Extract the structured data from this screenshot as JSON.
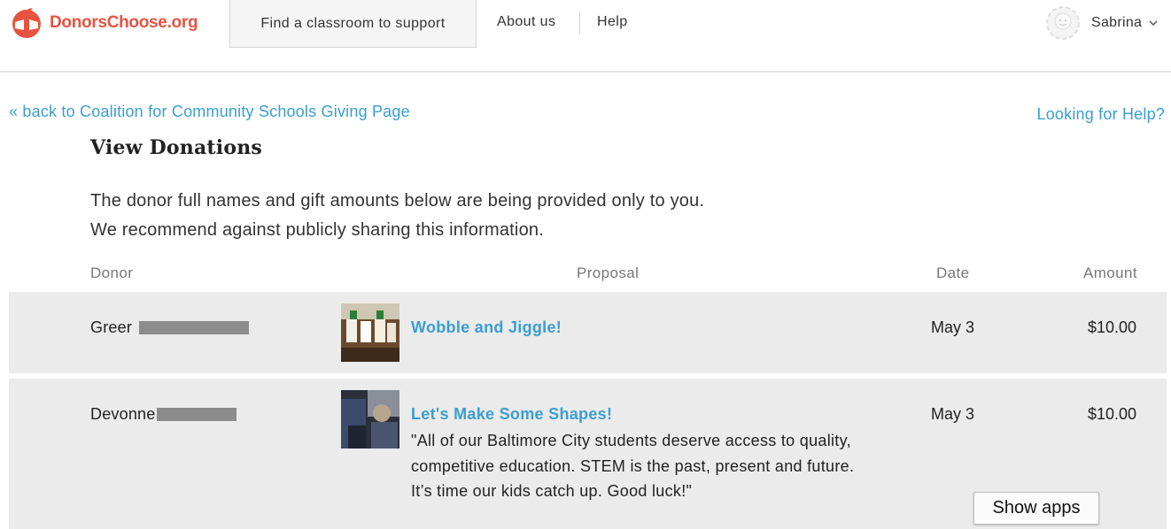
{
  "header": {
    "logo_text": "DonorsChoose.org",
    "find_label": "Find a classroom to support",
    "about_label": "About us",
    "help_label": "Help",
    "user_name": "Sabrina"
  },
  "links": {
    "back": "« back to Coalition for Community Schools Giving Page",
    "looking_help": "Looking for Help?"
  },
  "page": {
    "title": "View Donations",
    "notice_line1": "The donor full names and gift amounts below are being provided only to you.",
    "notice_line2": "We recommend against publicly sharing this information."
  },
  "table": {
    "headers": {
      "donor": "Donor",
      "proposal": "Proposal",
      "date": "Date",
      "amount": "Amount"
    },
    "rows": [
      {
        "donor": "Greer",
        "proposal_title": "Wobble and Jiggle!",
        "quote": "",
        "date": "May 3",
        "amount": "$10.00"
      },
      {
        "donor": "Devonne",
        "proposal_title": "Let's Make Some Shapes!",
        "quote": "\"All of our Baltimore City students deserve access to quality, competitive education. STEM is the past, present and future. It’s time our kids catch up. Good luck!\"",
        "date": "May 3",
        "amount": "$10.00"
      }
    ]
  },
  "overlay": {
    "show_apps": "Show apps"
  },
  "colors": {
    "brand": "#e8533f",
    "link": "#3a9ed1",
    "row_bg": "#ebebeb"
  },
  "icons": {
    "logo": "donorschoose-apple-logo-icon",
    "avatar": "user-avatar-icon",
    "chevron": "chevron-down-icon"
  }
}
